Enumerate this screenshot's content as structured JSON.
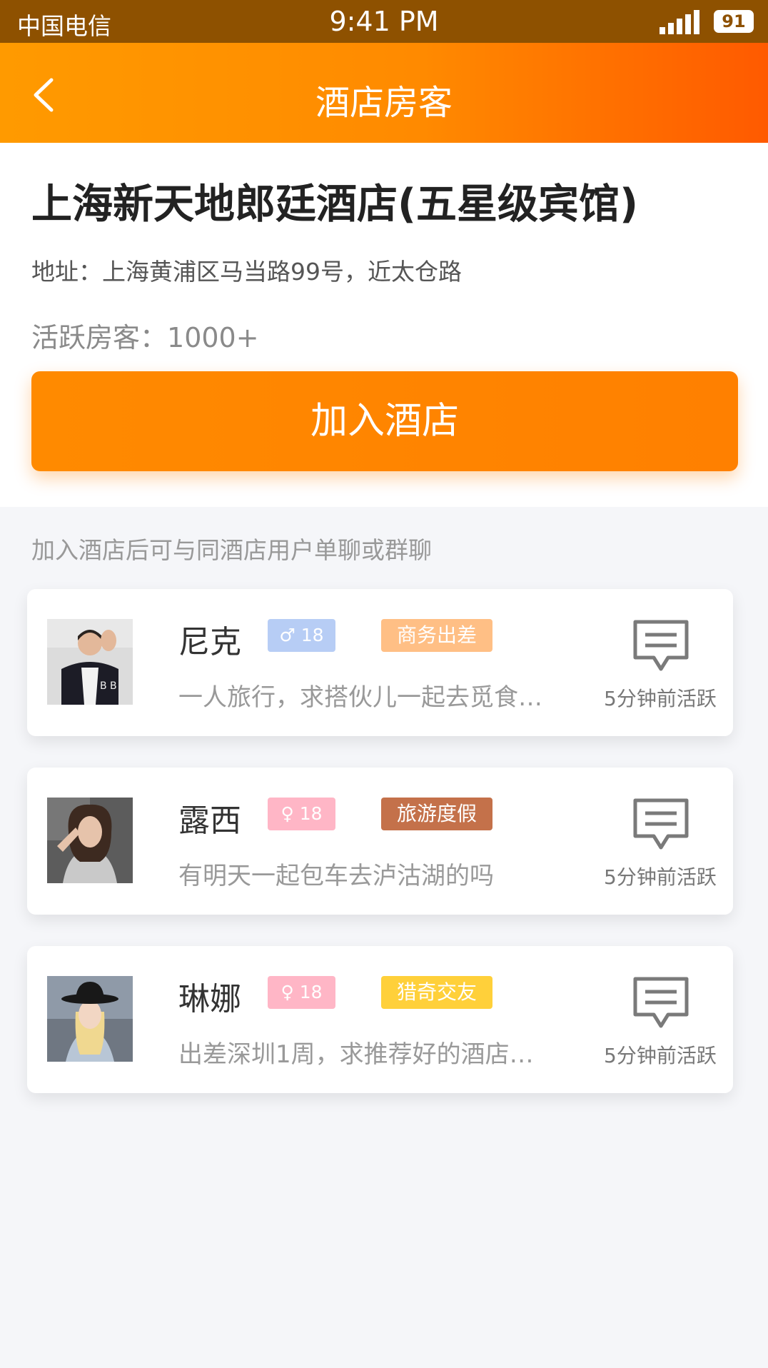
{
  "status_bar": {
    "carrier": "中国电信",
    "time": "9:41 PM",
    "battery": "91"
  },
  "nav": {
    "title": "酒店房客"
  },
  "hotel": {
    "name": "上海新天地郎廷酒店(五星级宾馆)",
    "address": "地址：上海黄浦区马当路99号，近太仓路",
    "active_label": "活跃房客：",
    "active_count": "1000+",
    "join_label": "加入酒店"
  },
  "hint": "加入酒店后可与同酒店用户单聊或群聊",
  "guests": [
    {
      "name": "尼克",
      "gender": "male",
      "gender_symbol": "♂",
      "age": "18",
      "tag": "商务出差",
      "tag_color": "#ffbf85",
      "bio": "一人旅行，求搭伙儿一起去觅食…",
      "active": "5分钟前活跃"
    },
    {
      "name": "露西",
      "gender": "female",
      "gender_symbol": "♀",
      "age": "18",
      "tag": "旅游度假",
      "tag_color": "#c4714a",
      "bio": "有明天一起包车去泸沽湖的吗",
      "active": "5分钟前活跃"
    },
    {
      "name": "琳娜",
      "gender": "female",
      "gender_symbol": "♀",
      "age": "18",
      "tag": "猎奇交友",
      "tag_color": "#ffd03a",
      "bio": "出差深圳1周，求推荐好的酒店…",
      "active": "5分钟前活跃"
    }
  ],
  "colors": {
    "accent": "#ff8a00",
    "status_bar": "#8e5100",
    "male_badge": "#b7cdf5",
    "female_badge": "#ffb6c6"
  },
  "icons": {
    "back": "chevron-left-icon",
    "chat": "chat-bubble-icon",
    "signal": "signal-bars-icon",
    "battery": "battery-icon"
  }
}
